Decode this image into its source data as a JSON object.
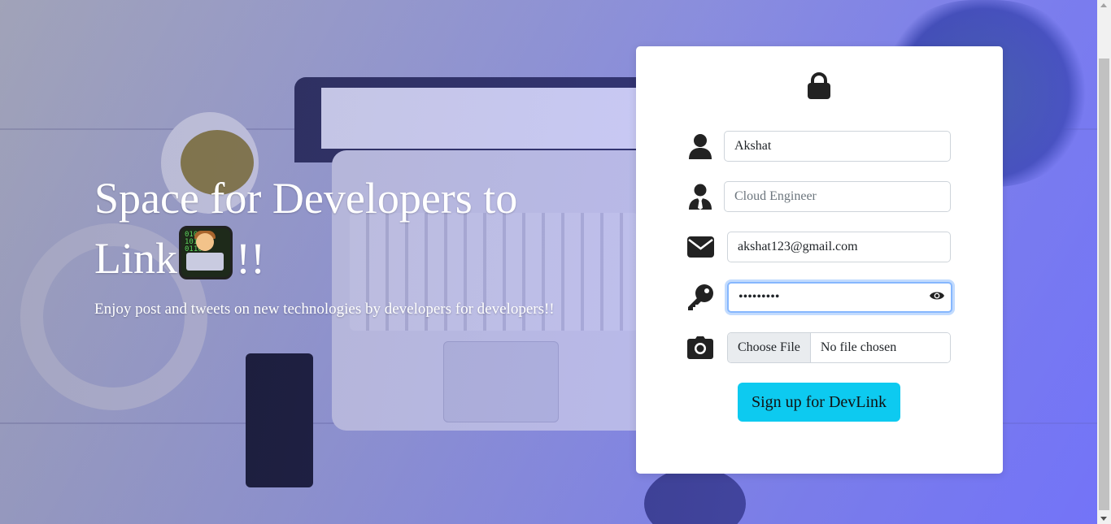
{
  "hero": {
    "title_line1": "Space for Developers to",
    "title_line2_prefix": "Link",
    "title_line2_suffix": "!!",
    "emoji_icon": "technologist-emoji",
    "subtitle": "Enjoy post and tweets on new technologies by developers for developers!!"
  },
  "form": {
    "lock_icon": "lock-icon",
    "name": {
      "icon": "user-icon",
      "value": "Akshat"
    },
    "profession": {
      "icon": "user-tie-icon",
      "placeholder": "Cloud Engineer"
    },
    "email": {
      "icon": "envelope-icon",
      "value": "akshat123@gmail.com"
    },
    "password": {
      "icon": "key-icon",
      "value": "akshat123",
      "toggle_icon": "eye-icon"
    },
    "photo": {
      "icon": "camera-icon",
      "button_label": "Choose File",
      "status": "No file chosen"
    },
    "submit_label": "Sign up for DevLink"
  },
  "colors": {
    "submit_bg": "#0dcaf0",
    "focus_ring": "#86b7fe"
  }
}
